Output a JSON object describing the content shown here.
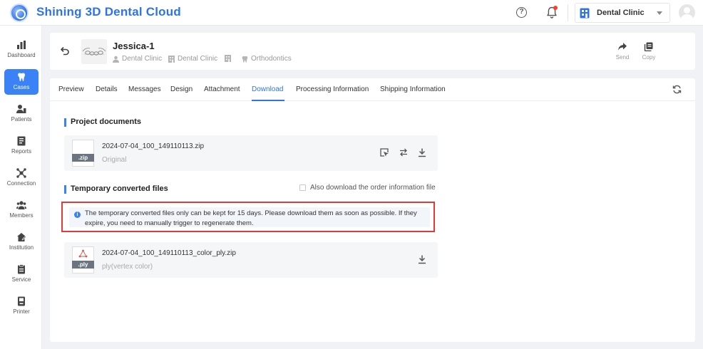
{
  "app": {
    "title": "Shining 3D Dental Cloud"
  },
  "topbar": {
    "help_icon": "help-circle-icon",
    "notification_icon": "bell-icon",
    "clinic_name": "Dental Clinic",
    "clinic_icon": "building-icon",
    "avatar_icon": "user-avatar-icon",
    "accent": "#2f73e8",
    "notification_dot": "#f5412a"
  },
  "sidebar": {
    "items": [
      {
        "label": "Dashboard",
        "icon": "bar-chart-icon",
        "active": false
      },
      {
        "label": "Cases",
        "icon": "tooth-icon",
        "active": true
      },
      {
        "label": "Patients",
        "icon": "patients-icon",
        "active": false
      },
      {
        "label": "Reports",
        "icon": "report-icon",
        "active": false
      },
      {
        "label": "Connection",
        "icon": "connection-icon",
        "active": false
      },
      {
        "label": "Members",
        "icon": "members-icon",
        "active": false
      },
      {
        "label": "Institution",
        "icon": "institution-icon",
        "active": false
      },
      {
        "label": "Service",
        "icon": "service-icon",
        "active": false
      },
      {
        "label": "Printer",
        "icon": "printer-icon",
        "active": false
      }
    ]
  },
  "case": {
    "name": "Jessica-1",
    "meta": [
      "Dental Clinic",
      "Dental Clinic",
      "",
      "Orthodontics"
    ],
    "actions": [
      {
        "label": "Send",
        "icon": "share-icon"
      },
      {
        "label": "Copy",
        "icon": "copy-icon"
      }
    ]
  },
  "tabs": {
    "items": [
      "Preview",
      "Details",
      "Messages",
      "Design",
      "Attachment",
      "Download",
      "Processing Information",
      "Shipping Information"
    ],
    "active": "Download"
  },
  "project_documents": {
    "title": "Project documents",
    "files": [
      {
        "ext": ".zip",
        "name": "2024-07-04_100_149110113.zip",
        "sub": "Original"
      }
    ]
  },
  "temporary_files": {
    "title": "Temporary converted files",
    "checkbox_label": "Also download the order information file",
    "checkbox_checked": false,
    "notice": "The temporary converted files only can be kept for 15 days. Please download them as soon as possible. If they expire, you need to manually trigger to regenerate them.",
    "files": [
      {
        "ext": ".ply",
        "name": "2024-07-04_100_149110113_color_ply.zip",
        "sub": "ply(vertex color)"
      }
    ]
  }
}
